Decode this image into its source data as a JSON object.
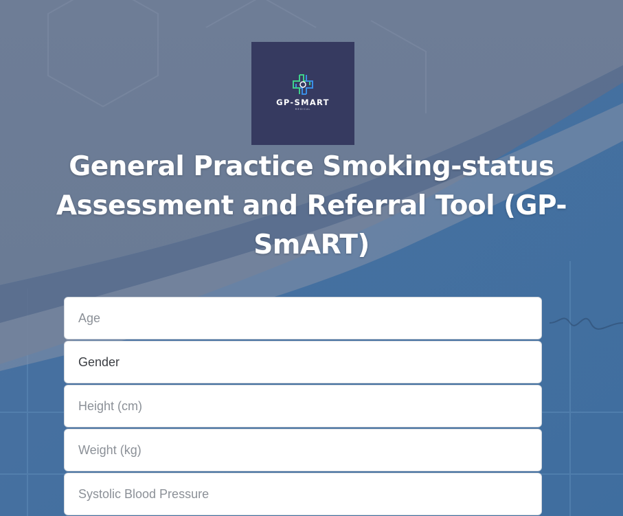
{
  "colors": {
    "background_top": "#6f7f99",
    "background_bottom": "#4c77a3",
    "logo_background": "#363a60",
    "logo_accent_green": "#3fd18a",
    "logo_accent_blue": "#3a8ee6",
    "title_text": "#ffffff"
  },
  "logo": {
    "icon": "medical-cross-icon",
    "name": "GP-SMART",
    "subtitle": "MEDICAL"
  },
  "title": "General Practice Smoking-status Assessment and Referral Tool (GP-SmART)",
  "form": {
    "age": {
      "placeholder": "Age",
      "value": ""
    },
    "gender": {
      "label": "Gender"
    },
    "height": {
      "placeholder": "Height (cm)",
      "value": ""
    },
    "weight": {
      "placeholder": "Weight (kg)",
      "value": ""
    },
    "systolic": {
      "placeholder": "Systolic Blood Pressure",
      "value": ""
    }
  }
}
